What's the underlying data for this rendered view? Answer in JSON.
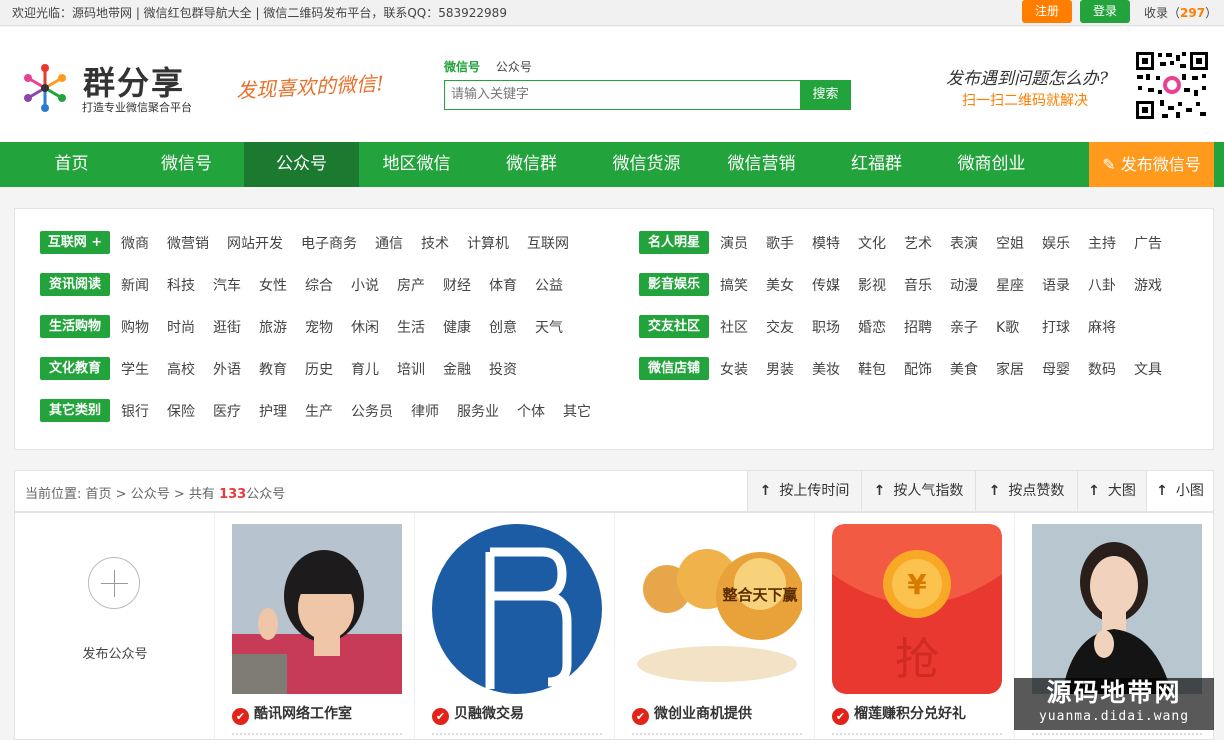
{
  "topbar": {
    "welcome": "欢迎光临：源码地带网 | 微信红包群导航大全 | 微信二维码发布平台，联系QQ：583922989",
    "register": "注册",
    "login": "登录",
    "favorites_label": "收录",
    "favorites_count": "297"
  },
  "header": {
    "logo_name": "群分享",
    "logo_sub": "打造专业微信聚合平台",
    "slogan": "发现喜欢的微信!",
    "search_tabs": [
      "微信号",
      "公众号"
    ],
    "search_placeholder": "请输入关键字",
    "search_button": "搜索",
    "help_line1": "发布遇到问题怎么办?",
    "help_line2": "扫一扫二维码就解决"
  },
  "nav": {
    "items": [
      "首页",
      "微信号",
      "公众号",
      "地区微信",
      "微信群",
      "微信货源",
      "微信营销",
      "红福群",
      "微商创业"
    ],
    "active": "公众号",
    "publish": "发布微信号"
  },
  "categories": {
    "left": [
      {
        "tag": "互联网 +",
        "items": [
          "微商",
          "微营销",
          "网站开发",
          "电子商务",
          "通信",
          "技术",
          "计算机",
          "互联网"
        ]
      },
      {
        "tag": "资讯阅读",
        "items": [
          "新闻",
          "科技",
          "汽车",
          "女性",
          "综合",
          "小说",
          "房产",
          "财经",
          "体育",
          "公益"
        ]
      },
      {
        "tag": "生活购物",
        "items": [
          "购物",
          "时尚",
          "逛街",
          "旅游",
          "宠物",
          "休闲",
          "生活",
          "健康",
          "创意",
          "天气"
        ]
      },
      {
        "tag": "文化教育",
        "items": [
          "学生",
          "高校",
          "外语",
          "教育",
          "历史",
          "育儿",
          "培训",
          "金融",
          "投资"
        ]
      },
      {
        "tag": "其它类别",
        "items": [
          "银行",
          "保险",
          "医疗",
          "护理",
          "生产",
          "公务员",
          "律师",
          "服务业",
          "个体",
          "其它"
        ]
      }
    ],
    "right": [
      {
        "tag": "名人明星",
        "items": [
          "演员",
          "歌手",
          "模特",
          "文化",
          "艺术",
          "表演",
          "空姐",
          "娱乐",
          "主持",
          "广告"
        ]
      },
      {
        "tag": "影音娱乐",
        "items": [
          "搞笑",
          "美女",
          "传媒",
          "影视",
          "音乐",
          "动漫",
          "星座",
          "语录",
          "八卦",
          "游戏"
        ]
      },
      {
        "tag": "交友社区",
        "items": [
          "社区",
          "交友",
          "职场",
          "婚恋",
          "招聘",
          "亲子",
          "K歌",
          "打球",
          "麻将"
        ]
      },
      {
        "tag": "微信店铺",
        "items": [
          "女装",
          "男装",
          "美妆",
          "鞋包",
          "配饰",
          "美食",
          "家居",
          "母婴",
          "数码",
          "文具"
        ]
      }
    ]
  },
  "list": {
    "breadcrumb_prefix": "当前位置:",
    "crumb_home": "首页",
    "crumb_section": "公众号",
    "total_prefix": "共有",
    "total": "133",
    "total_suffix": "公众号",
    "sort": [
      "按上传时间",
      "按人气指数",
      "按点赞数",
      "大图",
      "小图"
    ]
  },
  "cards": {
    "add_label": "发布公众号",
    "items": [
      {
        "title": "酷讯网络工作室"
      },
      {
        "title": "贝融微交易"
      },
      {
        "title": "微创业商机提供",
        "image_text": "整合天下赢"
      },
      {
        "title": "榴莲赚积分兑好礼"
      },
      {
        "title": ""
      }
    ]
  },
  "watermark": {
    "line1": "源码地带网",
    "line2": "yuanma.didai.wang"
  },
  "colors": {
    "brand_green": "#22a33b",
    "nav_active": "#1b7a30",
    "orange": "#ff7e00",
    "publish_orange": "#ff9a1d",
    "count_red": "#e83a3a"
  }
}
